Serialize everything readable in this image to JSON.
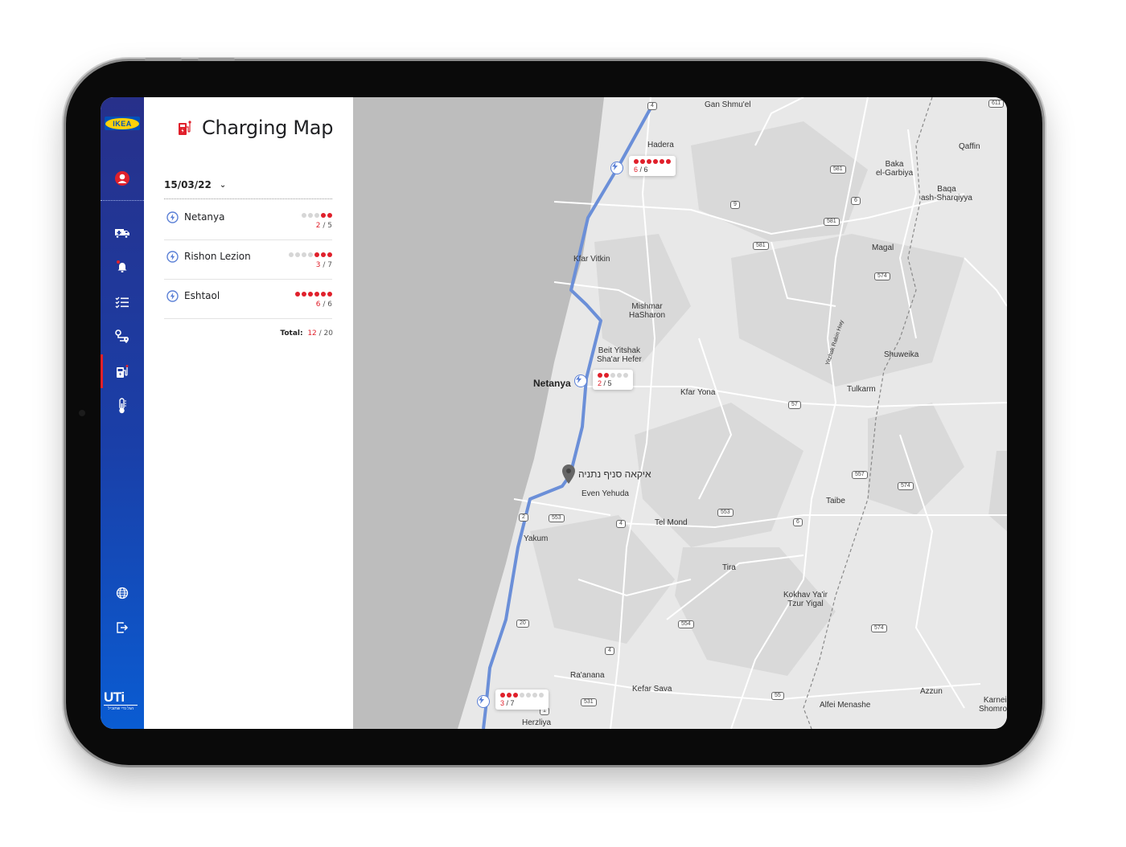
{
  "app": {
    "brand_logo": "IKEA",
    "partner_logo": "UTi",
    "partner_tagline": "הגל נדי שתוביל"
  },
  "sidebar": {
    "items": [
      {
        "icon": "user-avatar-icon",
        "label": "Profile"
      },
      {
        "icon": "delivery-truck-icon",
        "label": "Deliveries"
      },
      {
        "icon": "bell-icon",
        "label": "Notifications",
        "badge": true
      },
      {
        "icon": "checklist-icon",
        "label": "Tasks"
      },
      {
        "icon": "route-icon",
        "label": "Routes"
      },
      {
        "icon": "charging-station-icon",
        "label": "Charging Map",
        "active": true
      },
      {
        "icon": "thermometer-icon",
        "label": "Temperature"
      },
      {
        "icon": "globe-icon",
        "label": "Language"
      },
      {
        "icon": "logout-icon",
        "label": "Logout"
      }
    ]
  },
  "panel": {
    "title": "Charging Map",
    "date": "15/03/22",
    "stations": [
      {
        "name": "Netanya",
        "used": 2,
        "total": 5,
        "used_str": "2",
        "total_str": " / 5"
      },
      {
        "name": "Rishon Lezion",
        "used": 3,
        "total": 7,
        "used_str": "3",
        "total_str": " / 7"
      },
      {
        "name": "Eshtaol",
        "used": 6,
        "total": 6,
        "used_str": "6",
        "total_str": " / 6"
      }
    ],
    "total_label": "Total:",
    "total_used": "12",
    "total_capacity": " / 20"
  },
  "map": {
    "popups": [
      {
        "used": 6,
        "total": 6,
        "used_str": "6",
        "total_str": " / 6"
      },
      {
        "used": 2,
        "total": 5,
        "used_str": "2",
        "total_str": " / 5"
      },
      {
        "used": 3,
        "total": 7,
        "used_str": "3",
        "total_str": " / 7"
      }
    ],
    "destination_label": "איקאה סניף נתניה",
    "places": {
      "gan_shmuel": "Gan Shmu'el",
      "hadera": "Hadera",
      "qaffin": "Qaffin",
      "baka1": "Baka",
      "baka2": "el-Garbiya",
      "baqa1": "Baqa",
      "baqa2": "ash-Sharqiyya",
      "magal": "Magal",
      "kfar_vitkin": "Kfar Vitkin",
      "mishmar1": "Mishmar",
      "mishmar2": "HaSharon",
      "beit1": "Beit Yitshak",
      "beit2": "Sha'ar Hefer",
      "netanya": "Netanya",
      "kfar_yona": "Kfar Yona",
      "shuweika": "Shuweika",
      "tulkarm": "Tulkarm",
      "yitzhak_hwy": "Yitzhak Rabin Hwy",
      "even_yehuda": "Even Yehuda",
      "tel_mond": "Tel Mond",
      "taibe": "Taibe",
      "yakum": "Yakum",
      "tira": "Tira",
      "kokhav1": "Kokhav Ya'ir",
      "kokhav2": "Tzur Yigal",
      "raanana": "Ra'anana",
      "kefar_sava": "Kefar Sava",
      "azzun": "Azzun",
      "alfei": "Alfei Menashe",
      "karnei1": "Karnei",
      "karnei2": "Shomron",
      "herzliya": "Herzliya"
    },
    "road_shields": [
      "4",
      "611",
      "581",
      "6",
      "9",
      "581",
      "581",
      "574",
      "57",
      "557",
      "574",
      "553",
      "4",
      "6",
      "2",
      "553",
      "20",
      "554",
      "4",
      "574",
      "55",
      "531",
      "1"
    ],
    "colors": {
      "route": "#6b8fd8",
      "accent_red": "#e0202b",
      "sea": "#bdbdbd",
      "land": "#e8e8e8"
    }
  }
}
